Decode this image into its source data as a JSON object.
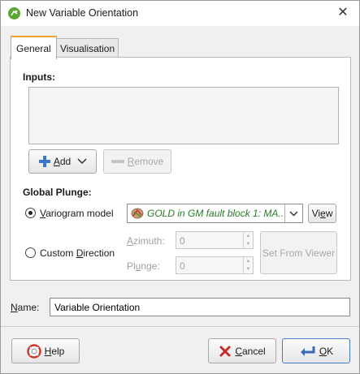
{
  "window": {
    "title": "New Variable Orientation"
  },
  "tabs": [
    {
      "label": "General",
      "active": true
    },
    {
      "label": "Visualisation",
      "active": false
    }
  ],
  "general": {
    "inputs_label": "Inputs:",
    "add_button": {
      "pre": "",
      "accel": "A",
      "post": "dd"
    },
    "remove_button": {
      "pre": "",
      "accel": "R",
      "post": "emove"
    },
    "global_plunge_label": "Global Plunge:",
    "variogram_option": {
      "pre": "",
      "accel": "V",
      "post": "ariogram model",
      "selected": true
    },
    "variogram_value": "GOLD in GM fault block 1: MA...",
    "view_button": {
      "pre": "Vi",
      "accel": "e",
      "post": "w"
    },
    "custom_option": {
      "pre": "Custom ",
      "accel": "D",
      "post": "irection",
      "selected": false
    },
    "azimuth": {
      "pre": "",
      "accel": "A",
      "post": "zimuth:",
      "value": "0"
    },
    "plunge": {
      "pre": "Pl",
      "accel": "u",
      "post": "nge:",
      "value": "0"
    },
    "set_from_viewer": "Set From Viewer"
  },
  "name_field": {
    "label_pre": "",
    "label_accel": "N",
    "label_post": "ame:",
    "value": "Variable Orientation"
  },
  "footer": {
    "help_button": {
      "pre": "",
      "accel": "H",
      "post": "elp"
    },
    "cancel_button": {
      "pre": "",
      "accel": "C",
      "post": "ancel"
    },
    "ok_button": {
      "pre": "",
      "accel": "O",
      "post": "K"
    }
  },
  "colors": {
    "active_tab_accent": "#f0a030",
    "combo_text": "#2a7a2a",
    "add_icon": "#3a78c8",
    "help_icon": "#d83a2a"
  }
}
